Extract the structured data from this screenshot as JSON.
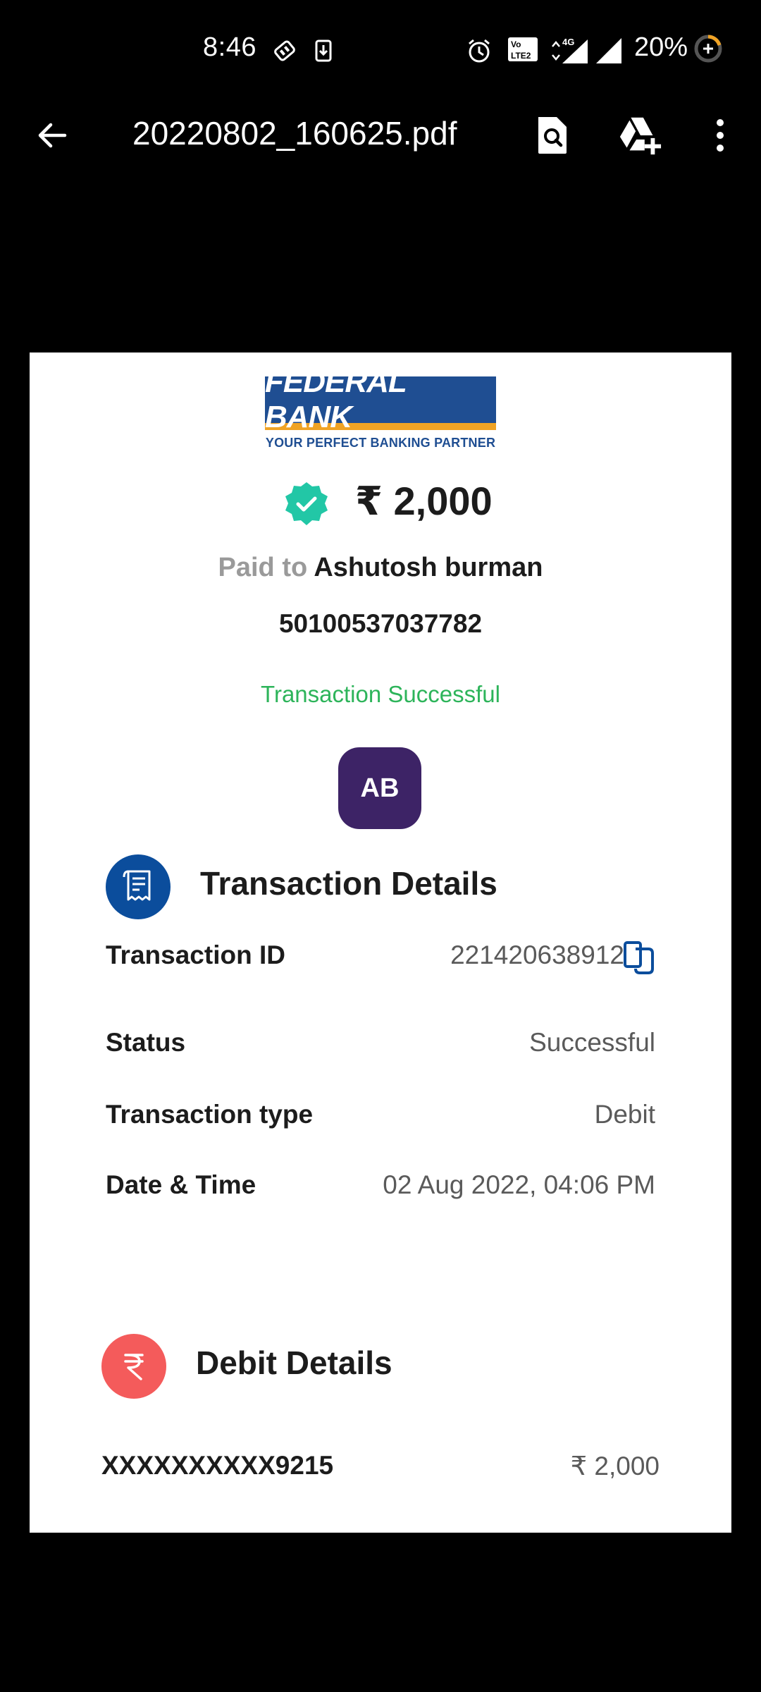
{
  "status_bar": {
    "time": "8:46",
    "battery": "20%",
    "icons": [
      "usb-debug-icon",
      "download-icon",
      "alarm-icon",
      "volte-icon",
      "signal-4g-icon",
      "signal-icon",
      "battery-saver-icon"
    ]
  },
  "app_bar": {
    "title": "20220802_160625.pdf",
    "icons": [
      "back-arrow-icon",
      "search-document-icon",
      "add-to-drive-icon",
      "more-vert-icon"
    ]
  },
  "receipt": {
    "bank_name": "FEDERAL BANK",
    "bank_tagline": "YOUR PERFECT BANKING PARTNER",
    "amount": "₹ 2,000",
    "paid_to_prefix": "Paid to",
    "payee_name": "Ashutosh burman",
    "account_number": "50100537037782",
    "status_message": "Transaction Successful",
    "avatar_initials": "AB",
    "transaction_details": {
      "title": "Transaction Details",
      "rows": [
        {
          "label": "Transaction ID",
          "value": "221420638912"
        },
        {
          "label": "Status",
          "value": "Successful"
        },
        {
          "label": "Transaction type",
          "value": "Debit"
        },
        {
          "label": "Date & Time",
          "value": "02 Aug 2022, 04:06 PM"
        }
      ]
    },
    "debit_details": {
      "title": "Debit Details",
      "account": "XXXXXXXXXX9215",
      "amount": "₹ 2,000"
    }
  },
  "colors": {
    "bank_blue": "#1f4e92",
    "bank_orange": "#f0a325",
    "success_green": "#2db45a",
    "verified_teal": "#22c7a6",
    "avatar_purple": "#3d2366",
    "section_blue": "#0b4d9c",
    "debit_red": "#f45b5b"
  }
}
